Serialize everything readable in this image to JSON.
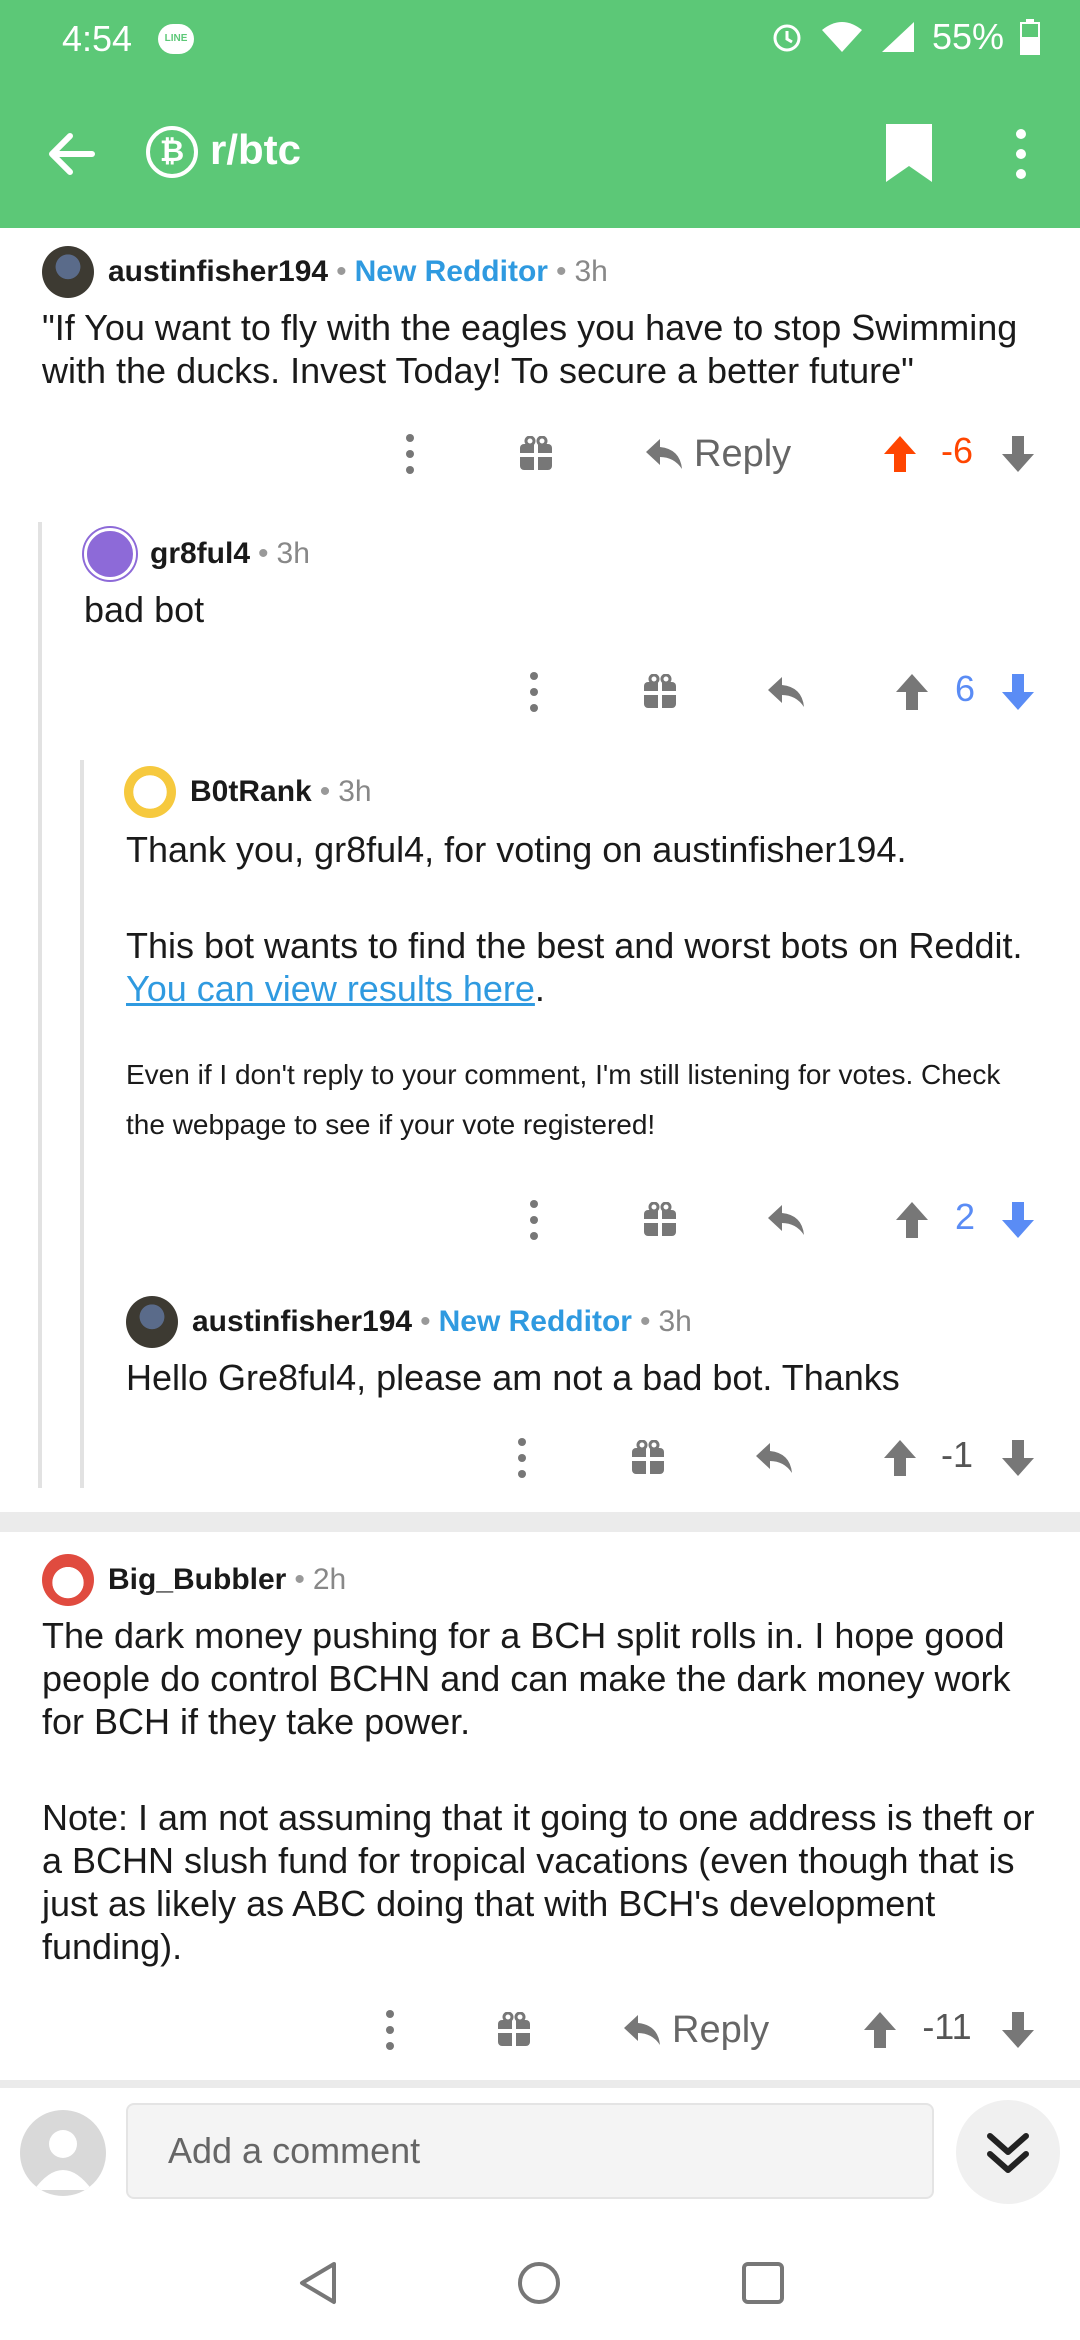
{
  "status_bar": {
    "time": "4:54",
    "line_badge": "LINE",
    "battery": "55%"
  },
  "app_bar": {
    "subreddit": "r/btc",
    "subreddit_icon": "₿"
  },
  "comments": [
    {
      "author": "austinfisher194",
      "flair": "New Redditor",
      "age": "3h",
      "body": "\"If You want to fly with the eagles you have to stop Swimming with the ducks. Invest Today! To secure a better future\"",
      "reply_label": "Reply",
      "score": "-6",
      "vote": "up"
    },
    {
      "author": "gr8ful4",
      "age": "3h",
      "body": "bad bot",
      "score": "6",
      "vote": "down"
    },
    {
      "author": "B0tRank",
      "age": "3h",
      "body_line1": "Thank you, gr8ful4, for voting on austinfisher194.",
      "body_line2": "This bot wants to find the best and worst bots on Reddit.",
      "link_text": "You can view results here",
      "link_suffix": ".",
      "small_text": "Even if I don't reply to your comment, I'm still listening for votes. Check the webpage to see if your vote registered!",
      "score": "2",
      "vote": "down"
    },
    {
      "author": "austinfisher194",
      "flair": "New Redditor",
      "age": "3h",
      "body": "Hello Gre8ful4, please am not a bad bot. Thanks",
      "score": "-1",
      "vote": "none"
    },
    {
      "author": "Big_Bubbler",
      "age": "2h",
      "body_p1": "The dark money pushing for a BCH split rolls in. I hope good people do control BCHN and can make the dark money work for BCH if they take power.",
      "body_p2": "Note: I am not assuming that it going to one address is theft or a BCHN slush fund for tropical vacations (even though that is just as likely as ABC doing that with BCH's development funding).",
      "reply_label": "Reply",
      "score": "-11",
      "vote": "none"
    }
  ],
  "composer": {
    "placeholder": "Add a comment"
  },
  "colors": {
    "header": "#5cc877",
    "upvote": "#ff4500",
    "downvote": "#5a8cf5",
    "link": "#2f9ae0"
  },
  "icons": [
    "back-arrow-icon",
    "bitcoin-icon",
    "bookmark-icon",
    "more-vert-icon",
    "overflow-icon",
    "gift-icon",
    "reply-icon",
    "upvote-icon",
    "downvote-icon",
    "collapse-icon",
    "nav-back-icon",
    "nav-home-icon",
    "nav-recents-icon"
  ]
}
